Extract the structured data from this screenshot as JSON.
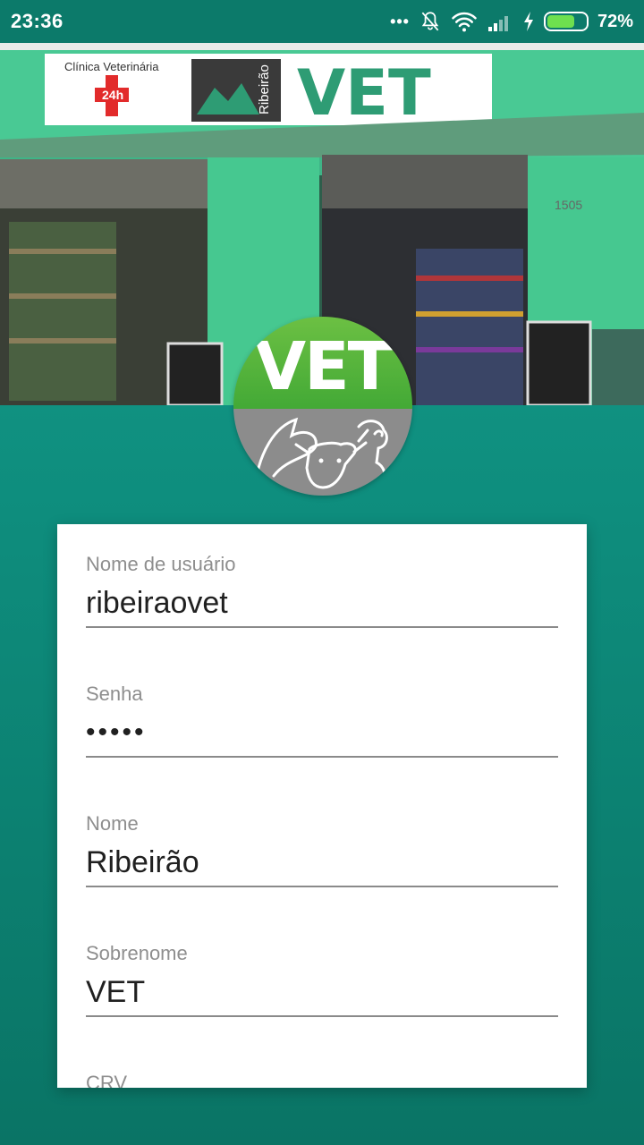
{
  "status_bar": {
    "time": "23:36",
    "battery": "72%",
    "battery_level": 0.72,
    "icons": [
      "more-dots-icon",
      "bell-off-icon",
      "wifi-icon",
      "signal-icon",
      "charging-icon",
      "battery-icon"
    ]
  },
  "hero": {
    "clinic_line": "Clínica Veterinária",
    "badge": "24h",
    "brand_small": "Ribeirão",
    "brand_big": "VET",
    "number": "1505"
  },
  "logo": {
    "text": "VET",
    "colors": {
      "top": "#4CAF38",
      "bottom": "#8C8C8C"
    }
  },
  "form": {
    "fields": [
      {
        "label": "Nome de usuário",
        "value": "ribeiraovet"
      },
      {
        "label": "Senha",
        "value": "•••••"
      },
      {
        "label": "Nome",
        "value": "Ribeirão"
      },
      {
        "label": "Sobrenome",
        "value": "VET"
      },
      {
        "label": "CRV",
        "value": ""
      }
    ]
  },
  "colors": {
    "accent": "#0C7A6A",
    "background": "#17A08F"
  }
}
